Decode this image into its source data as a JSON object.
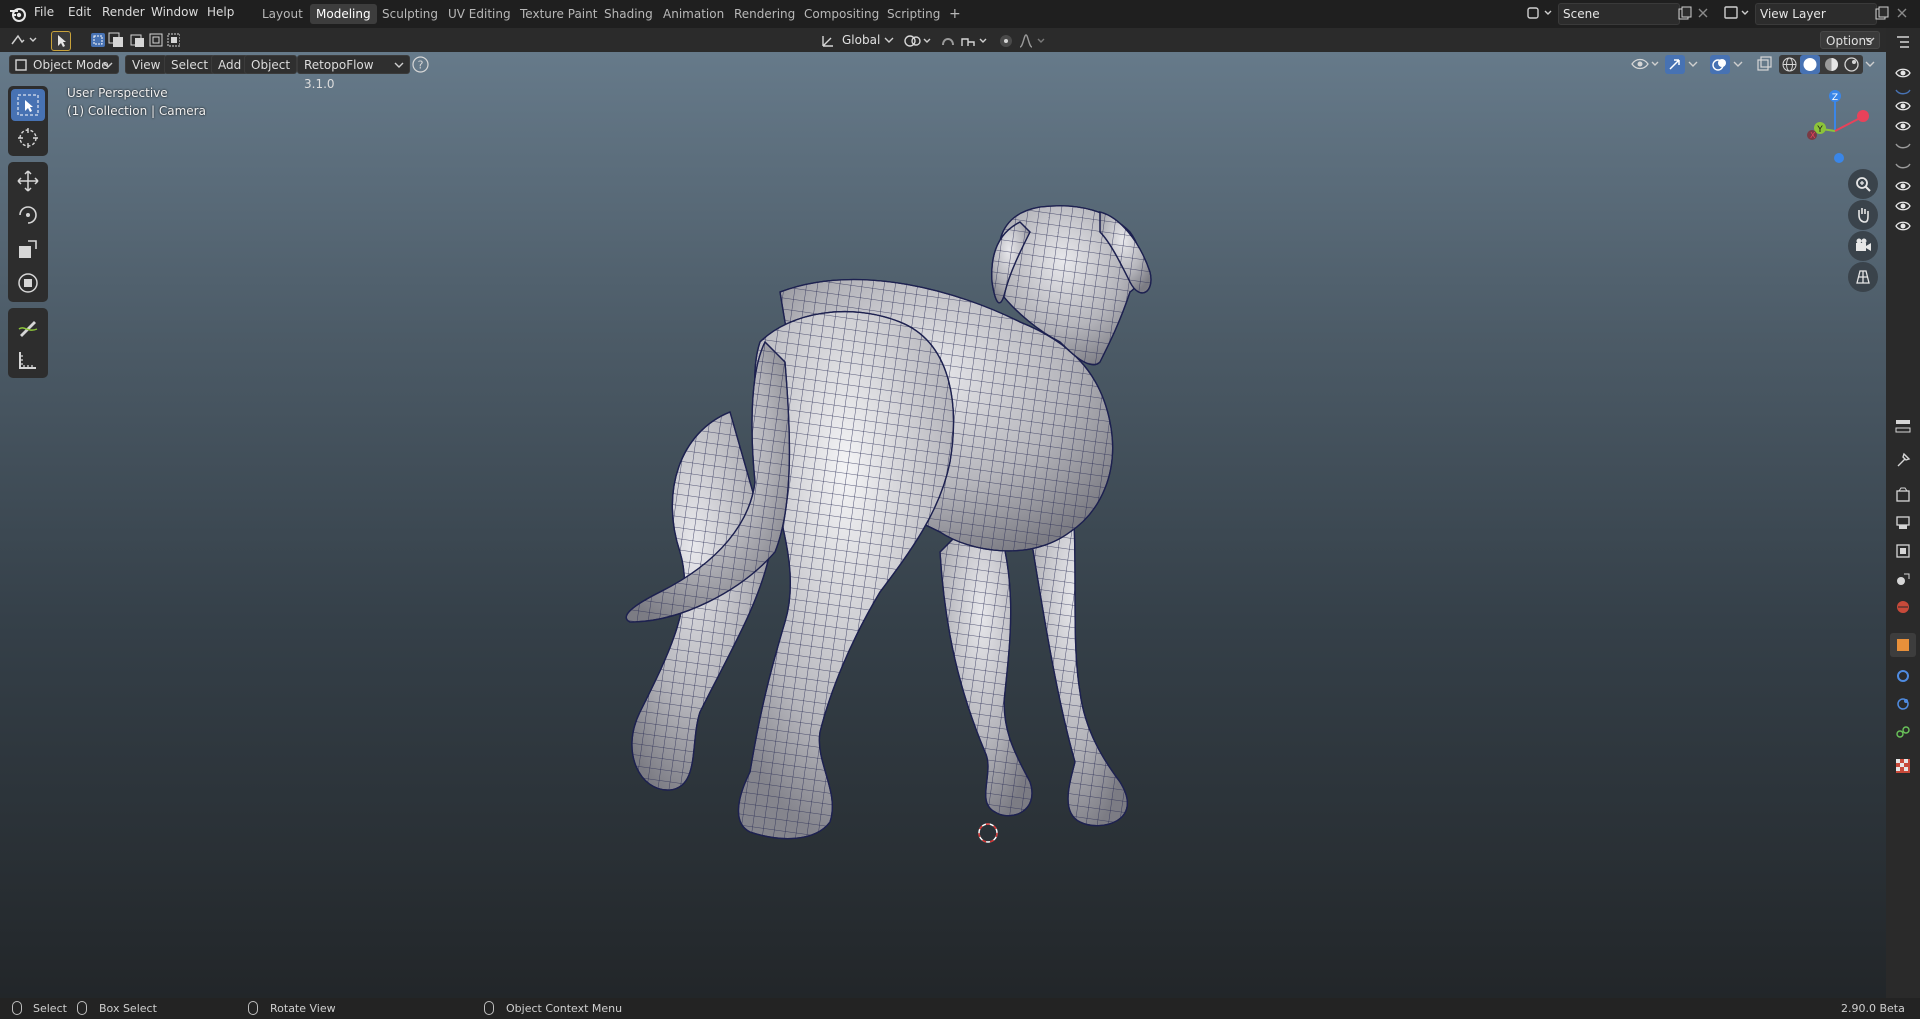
{
  "menubar": {
    "items": [
      "File",
      "Edit",
      "Render",
      "Window",
      "Help"
    ],
    "workspaces": [
      "Layout",
      "Modeling",
      "Sculpting",
      "UV Editing",
      "Texture Paint",
      "Shading",
      "Animation",
      "Rendering",
      "Compositing",
      "Scripting"
    ],
    "active_workspace": "Modeling",
    "add_tab": "+",
    "scene_name": "Scene",
    "view_layer": "View Layer"
  },
  "header": {
    "transform_orientation": "Global",
    "options_label": "Options"
  },
  "viewport_header": {
    "mode": "Object Mode",
    "menus": [
      "View",
      "Select",
      "Add",
      "Object"
    ],
    "addon": "RetopoFlow 3.1.0",
    "help_icon": "question-icon"
  },
  "viewport": {
    "perspective_label": "User Perspective",
    "collection_label": "(1) Collection | Camera",
    "gizmo_axes": {
      "z": "Z",
      "y": "Y",
      "x": "X"
    }
  },
  "toolbar": {
    "tools": [
      "select-box-icon",
      "cursor-icon",
      "move-icon",
      "rotate-icon",
      "scale-icon",
      "transform-icon",
      "annotate-icon",
      "measure-icon"
    ],
    "active_tool": "select-box-icon"
  },
  "statusbar": {
    "select": "Select",
    "box_select": "Box Select",
    "rotate_view": "Rotate View",
    "context_menu": "Object Context Menu",
    "version": "2.90.0 Beta"
  },
  "colors": {
    "accent": "#4772b3",
    "viewport_top": "#667a8a",
    "viewport_bottom": "#222629",
    "x_axis": "#e8425a",
    "y_axis": "#8cc43a",
    "z_axis": "#3a86e8"
  }
}
